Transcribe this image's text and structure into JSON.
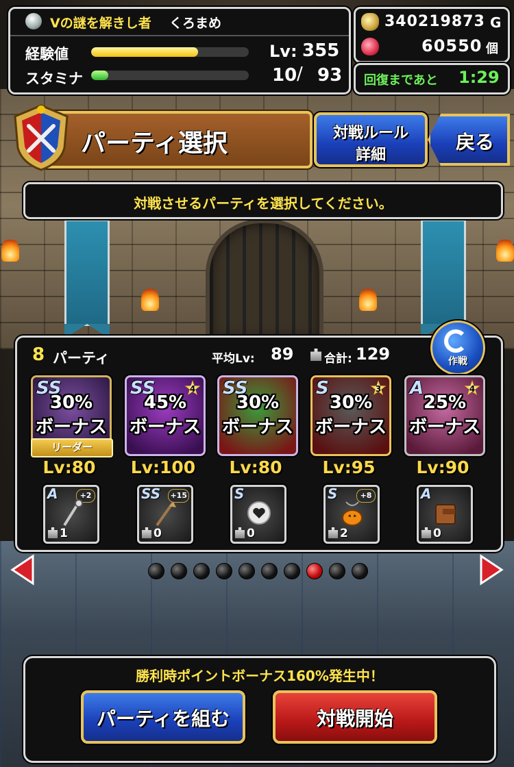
{
  "status": {
    "player_title": "Vの謎を解きし者",
    "player_name": "くろまめ",
    "exp_label": "経験値",
    "exp_progress": 0.68,
    "level_label": "Lv:",
    "level": "355",
    "stamina_label": "スタミナ",
    "stamina_progress": 0.108,
    "stamina_current": "10",
    "stamina_sep": "/",
    "stamina_max": "93"
  },
  "currency": {
    "gold": "340219873",
    "gold_unit": "G",
    "gems": "60550",
    "gems_unit": "個",
    "recover_label": "回復まであと",
    "recover_time": "1:29"
  },
  "header": {
    "title": "パーティ選択",
    "rules_button_line1": "対戦ルール",
    "rules_button_line2": "詳細",
    "back_button": "戻る"
  },
  "instruction": "対戦させるパーティを選択してください。",
  "party": {
    "number": "8",
    "label": "パーティ",
    "avg_level_label": "平均Lv:",
    "avg_level": "89",
    "total_label": "合計:",
    "total_weight": "129",
    "strategy_label": "作戦",
    "leader_label": "リーダー",
    "bonus_word": "ボーナス",
    "monsters": [
      {
        "rank": "SS",
        "bonus": "30%",
        "level": "Lv:80",
        "plus": "",
        "border": "#d4b45a",
        "bg1": "#7b4fa0",
        "bg2": "#2a1640",
        "weapon": {
          "rank": "A",
          "plus": "+2",
          "weight": "1",
          "icon": "staff-icon"
        }
      },
      {
        "rank": "SS",
        "bonus": "45%",
        "level": "Lv:100",
        "plus": "4",
        "border": "#c9b5e6",
        "bg1": "#9b3cc0",
        "bg2": "#3a0f52",
        "weapon": {
          "rank": "SS",
          "plus": "+15",
          "weight": "0",
          "icon": "spear-icon"
        }
      },
      {
        "rank": "SS",
        "bonus": "30%",
        "level": "Lv:80",
        "plus": "",
        "border": "#c9b5e6",
        "bg1": "#3c9a3c",
        "bg2": "#7a1616",
        "weapon": {
          "rank": "S",
          "plus": "",
          "weight": "0",
          "icon": "orb-icon"
        }
      },
      {
        "rank": "S",
        "bonus": "30%",
        "level": "Lv:95",
        "plus": "3",
        "border": "#e8c35c",
        "bg1": "#5a5a5a",
        "bg2": "#5a1010",
        "weapon": {
          "rank": "S",
          "plus": "+8",
          "weight": "2",
          "icon": "pumpkin-icon"
        }
      },
      {
        "rank": "A",
        "bonus": "25%",
        "level": "Lv:90",
        "plus": "4",
        "border": "#c0c0c0",
        "bg1": "#c46aa0",
        "bg2": "#5a1a3a",
        "weapon": {
          "rank": "A",
          "plus": "",
          "weight": "0",
          "icon": "book-icon"
        }
      }
    ]
  },
  "pager": {
    "count": 10,
    "active_index": 7
  },
  "bottom": {
    "bonus_notice": "勝利時ポイントボーナス160%発生中！",
    "form_party_button": "パーティを組む",
    "start_battle_button": "対戦開始"
  }
}
